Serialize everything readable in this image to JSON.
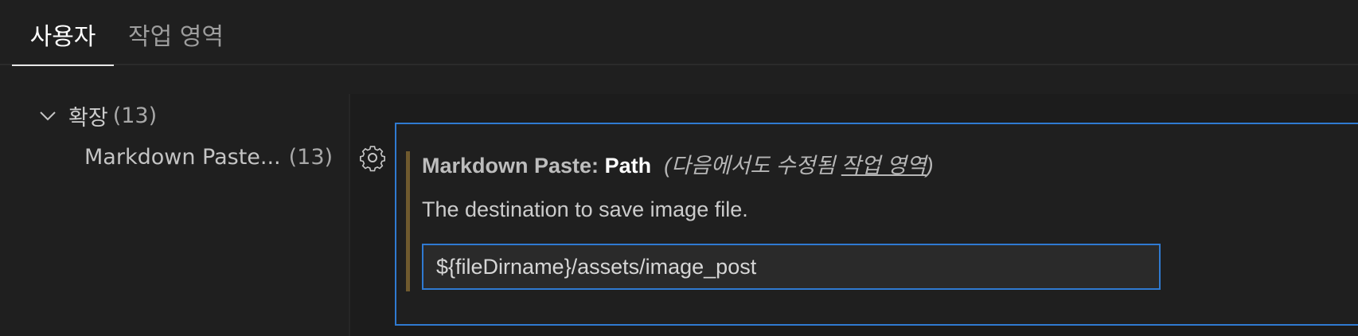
{
  "tabs": [
    {
      "label": "사용자",
      "active": true
    },
    {
      "label": "작업 영역",
      "active": false
    }
  ],
  "toc": {
    "group_label": "확장",
    "group_count": "(13)",
    "item_label": "Markdown Paste...",
    "item_count": "(13)"
  },
  "setting": {
    "category": "Markdown Paste: ",
    "name": "Path",
    "note_prefix": "(다음에서도 수정됨 ",
    "note_link": "작업 영역",
    "note_suffix": ")",
    "description": "The destination to save image file.",
    "value": "${fileDirname}/assets/image_post"
  },
  "colors": {
    "accent": "#2f7ad1",
    "modified_indicator": "#6f5a2e",
    "background": "#1f1f1f"
  },
  "icons": {
    "group_toggle": "chevron-down-icon",
    "setting_menu": "gear-icon"
  }
}
